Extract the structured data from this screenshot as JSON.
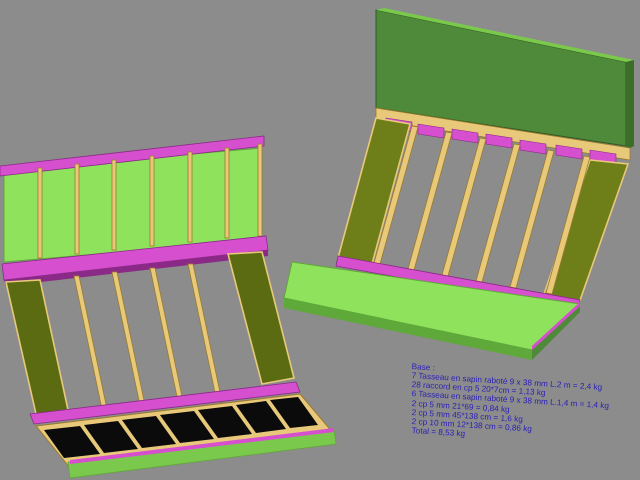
{
  "scene": {
    "background": "#8c8c8c",
    "colors": {
      "panel_green": "#8fe25c",
      "panel_green_dark": "#5fa83a",
      "frame_magenta": "#d64fcf",
      "frame_magenta_dark": "#8a2a86",
      "batten_yellow": "#e8c97a",
      "batten_yellow_dark": "#9c7a2c",
      "olive_side": "#5a6b12",
      "olive_side_light": "#7d8f24",
      "black_inset": "#0b0b0b",
      "back_panel": "#4f8a3a",
      "text_blue": "#2a1fb8"
    }
  },
  "notes": {
    "title": "Base :",
    "lines": [
      "7 Tasseau en sapin raboté 9 x 38 mm L.2 m = 2,4 kg",
      "28 raccord en cp 5 20*7cm = 1,13 kg",
      "6 Tasseau en sapin raboté 9 x 38 mm L.1,4 m = 1,4 kg",
      "2 cp 5 mm 21*69 = 0,84 kg",
      "2 cp 5 mm 45*138 cm = 1,6 kg",
      "2 cp 10 mm 12*138 cm = 0,86 kg",
      "Total = 8,53 kg"
    ]
  }
}
